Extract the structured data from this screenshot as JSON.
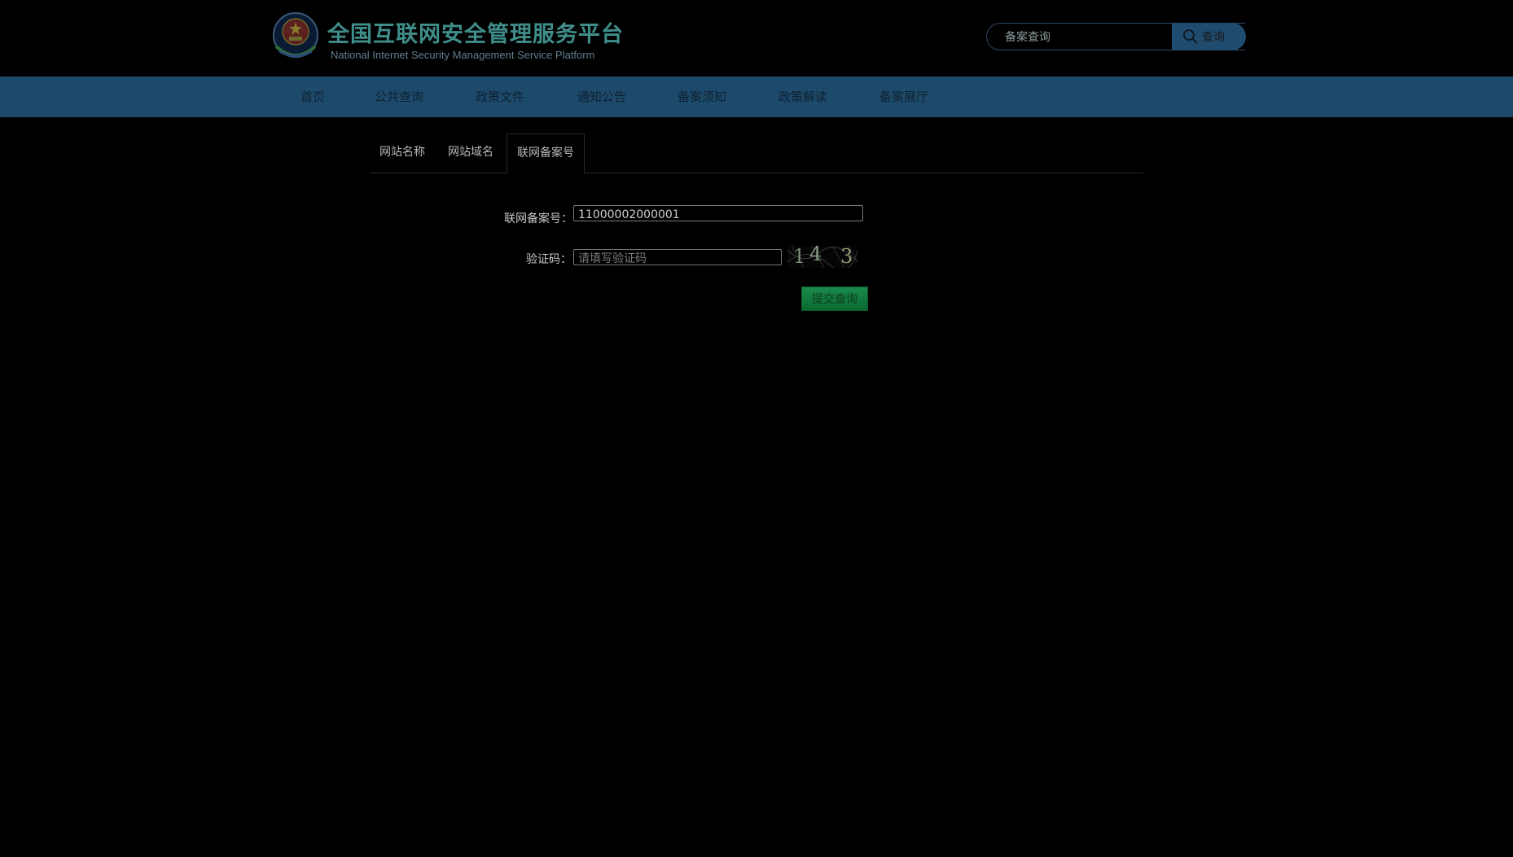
{
  "header": {
    "title": "全国互联网安全管理服务平台",
    "subtitle": "National Internet Security Management Service Platform",
    "search_placeholder": "备案查询",
    "search_button": "查询"
  },
  "nav": {
    "items": [
      "首页",
      "公共查询",
      "政策文件",
      "通知公告",
      "备案须知",
      "政策解读",
      "备案展厅"
    ]
  },
  "tabs": [
    "网站名称",
    "网站域名",
    "联网备案号"
  ],
  "active_tab": "联网备案号",
  "form": {
    "record_label": "联网备案号：",
    "record_value": "11000002000001",
    "captcha_label": "验证码：",
    "captcha_placeholder": "请填写验证码",
    "captcha_text": [
      "1",
      "4",
      "3"
    ],
    "submit_label": "提交查询"
  },
  "colors": {
    "nav_bg": "#1d4a6b",
    "submit_bg": "#0a7a3a",
    "title": "#3f8e8a"
  }
}
